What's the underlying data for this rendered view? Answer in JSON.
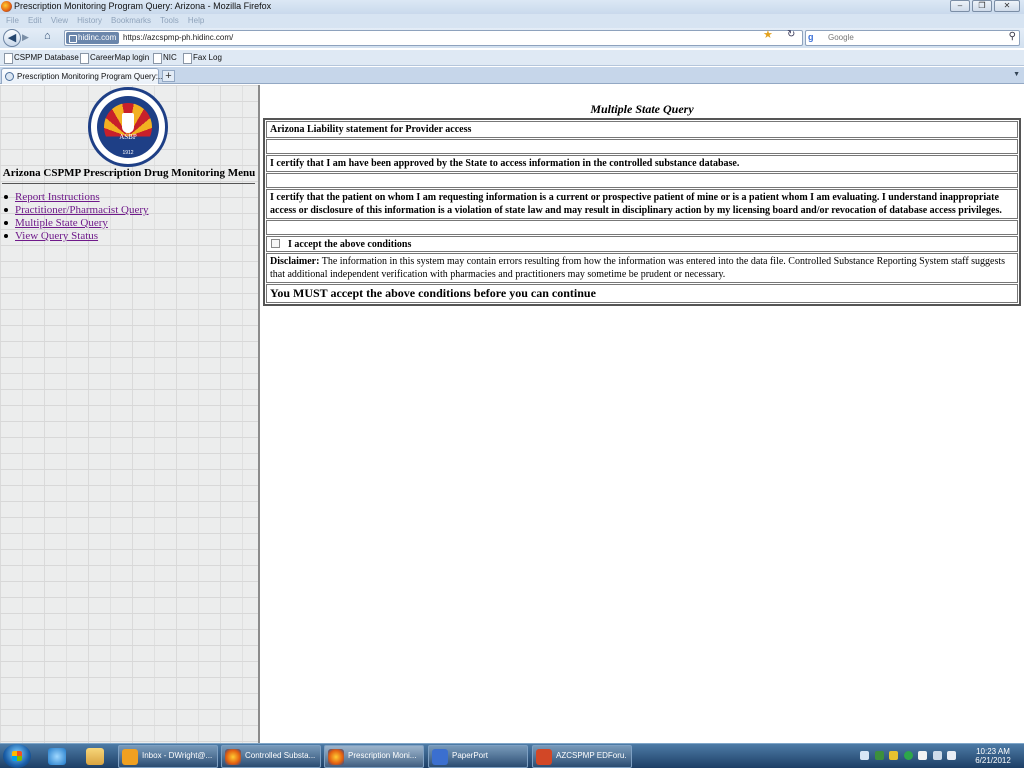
{
  "window": {
    "title": "Prescription Monitoring Program Query: Arizona - Mozilla Firefox",
    "controls": [
      "minimize",
      "restore",
      "close"
    ]
  },
  "menubar": [
    "File",
    "Edit",
    "View",
    "History",
    "Bookmarks",
    "Tools",
    "Help"
  ],
  "navigation": {
    "identity_label": "hidinc.com",
    "url": "https://azcspmp-ph.hidinc.com/",
    "search_engine": "Google",
    "search_placeholder": "Google"
  },
  "bookmarks": [
    "CSPMP Database",
    "CareerMap login",
    "NIC",
    "Fax Log"
  ],
  "tab": {
    "label": "Prescription Monitoring Program Query:...",
    "new_tab": "+"
  },
  "sidebar": {
    "seal_abbr": "ASBP",
    "seal_year": "1912",
    "menu_title": "Arizona CSPMP  Prescription Drug Monitoring Menu",
    "items": [
      {
        "label": "Report Instructions"
      },
      {
        "label": "Practitioner/Pharmacist Query"
      },
      {
        "label": "Multiple State Query"
      },
      {
        "label": "View Query Status"
      }
    ]
  },
  "main": {
    "title": "Multiple State Query",
    "liability_heading": "Arizona Liability statement for Provider access",
    "certify_approved": "I certify that I am have been approved by the State to access information in the controlled substance database.",
    "certify_patient": "I certify that the patient on whom I am requesting information is a current or prospective patient of mine or is a patient whom I am evaluating. I understand inappropriate access or disclosure of this information is a violation of state law and may result in disciplinary action by my licensing board and/or revocation of database access privileges.",
    "accept_label": "I accept the above conditions",
    "accept_checked": false,
    "disclaimer_label": "Disclaimer:",
    "disclaimer_text": " The information in this system may contain errors resulting from how the information was entered into the data file. Controlled Substance Reporting System staff suggests that additional independent verification with pharmacies and practitioners may sometime be prudent or necessary.",
    "must_accept": "You MUST accept the above conditions before you can continue"
  },
  "taskbar": {
    "pinned": [
      "internet-explorer",
      "file-explorer"
    ],
    "buttons": [
      {
        "label": "Inbox - DWright@...",
        "icon": "outlook-icon",
        "color": "#f0a020"
      },
      {
        "label": "Controlled Substa...",
        "icon": "firefox-icon",
        "color": "#e25d10"
      },
      {
        "label": "Prescription Moni...",
        "icon": "firefox-icon",
        "color": "#e25d10"
      },
      {
        "label": "PaperPort",
        "icon": "paperport-icon",
        "color": "#3b6fcf"
      },
      {
        "label": "AZCSPMP EDForu...",
        "icon": "powerpoint-icon",
        "color": "#d24726"
      }
    ],
    "clock_time": "10:23 AM",
    "clock_date": "6/21/2012"
  },
  "colors": {
    "link_visited": "#6f1a8a",
    "seal_blue": "#1e3f86",
    "taskbar": "#2a5480"
  }
}
